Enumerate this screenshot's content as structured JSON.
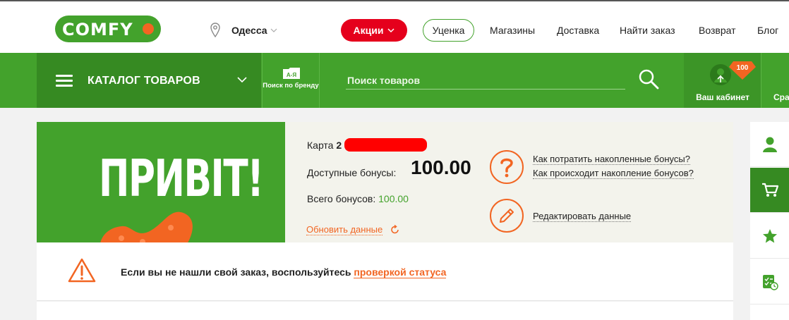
{
  "header": {
    "logo_text": "COMFY",
    "city": "Одесса",
    "promo_label": "Акции",
    "markdown_label": "Уценка",
    "nav": [
      "Магазины",
      "Доставка",
      "Найти заказ",
      "Возврат",
      "Блог"
    ]
  },
  "greenbar": {
    "catalog_label": "КАТАЛОГ ТОВАРОВ",
    "brand_icon_text": "А-Я",
    "brand_search_label": "Поиск по бренду",
    "search_placeholder": "Поиск товаров",
    "cabinet_label": "Ваш кабинет",
    "cabinet_badge": "100",
    "compare_label_partial": "Сра"
  },
  "bonus": {
    "banner_text": "ПРИВІТ!",
    "card_label": "Карта",
    "card_number_visible": "2",
    "available_label": "Доступные бонусы:",
    "available_value": "100.00",
    "total_label": "Всего бонусов:",
    "total_value": "100.00",
    "refresh_label": "Обновить данные",
    "how_spend": "Как потратить накопленные бонусы?",
    "how_accrue": "Как происходит накопление бонусов?",
    "edit_data": "Редактировать данные"
  },
  "alert": {
    "text": "Если вы не нашли свой заказ, воспользуйтесь ",
    "link": "проверкой статуса"
  },
  "colors": {
    "brand_green": "#43a22c",
    "dark_green": "#368a22",
    "accent_orange": "#f26522",
    "promo_red": "#e5001c"
  }
}
